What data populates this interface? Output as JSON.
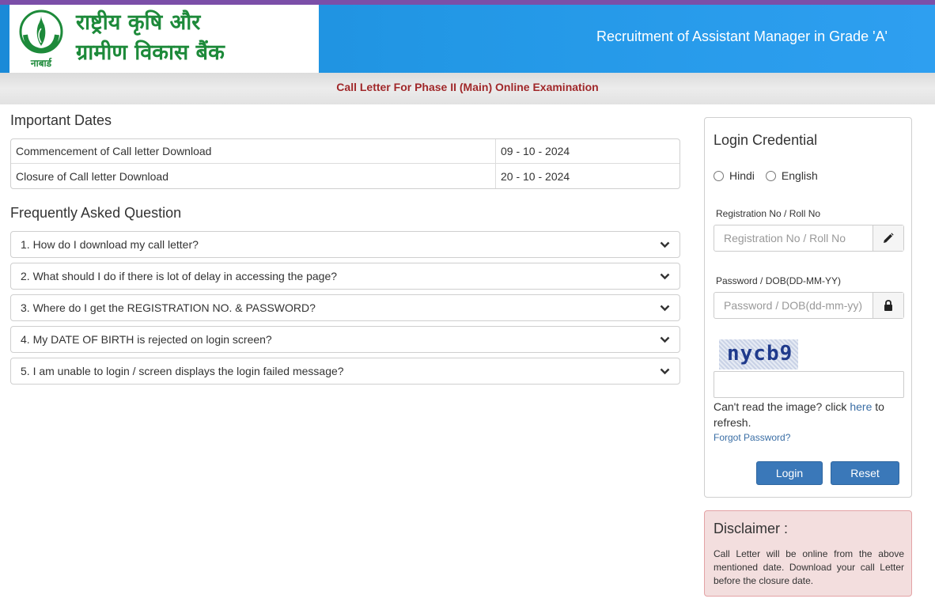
{
  "header": {
    "logo_hindi_line1": "राष्ट्रीय कृषि और",
    "logo_hindi_line2": "ग्रामीण विकास बैंक",
    "logo_small": "नाबार्ड",
    "title": "Recruitment of Assistant Manager in Grade 'A'"
  },
  "subbar": {
    "text": "Call Letter For Phase II (Main) Online Examination"
  },
  "important_dates": {
    "title": "Important Dates",
    "rows": [
      {
        "label": "Commencement of Call letter Download",
        "value": "09 - 10 - 2024"
      },
      {
        "label": "Closure of Call letter Download",
        "value": "20 - 10 - 2024"
      }
    ]
  },
  "faq": {
    "title": "Frequently Asked Question",
    "items": [
      "1. How do I download my call letter?",
      "2. What should I do if there is lot of delay in accessing the page?",
      "3. Where do I get the REGISTRATION NO. & PASSWORD?",
      "4. My DATE OF BIRTH is rejected on login screen?",
      "5. I am unable to login / screen displays the login failed message?"
    ]
  },
  "login": {
    "title": "Login Credential",
    "lang_options": [
      "Hindi",
      "English"
    ],
    "reg_label": "Registration No / Roll No",
    "reg_placeholder": "Registration No / Roll No",
    "pwd_label": "Password / DOB(DD-MM-YY)",
    "pwd_placeholder": "Password / DOB(dd-mm-yy)",
    "captcha_text": "nycb9",
    "refresh_prefix": "Can't read the image? click ",
    "refresh_link": "here",
    "refresh_suffix": " to refresh.",
    "forgot": "Forgot Password?",
    "login_button": "Login",
    "reset_button": "Reset"
  },
  "disclaimer": {
    "title": "Disclaimer :",
    "text": "Call Letter will be online from the above mentioned date. Download your call Letter before the closure date."
  },
  "colors": {
    "header_blue": "#2398e6",
    "subbar_text": "#a0282a",
    "button_blue": "#3a78b9",
    "logo_green": "#1d8a3a",
    "disclaimer_bg": "#f3dede"
  }
}
